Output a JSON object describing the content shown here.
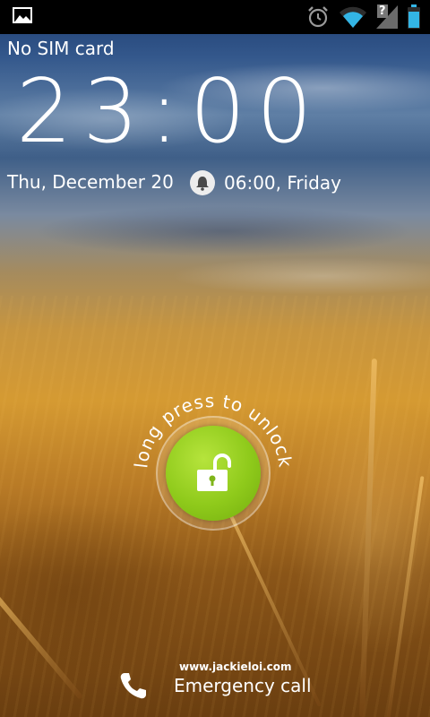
{
  "status_bar": {
    "icons_left": [
      "gallery-icon"
    ],
    "icons_right": [
      "alarm-icon",
      "wifi-icon",
      "no-sim-icon",
      "battery-icon"
    ],
    "no_sim_glyph": "?"
  },
  "lockscreen": {
    "carrier": "No SIM card",
    "time": "23:00",
    "date": "Thu, December 20",
    "next_alarm": "06:00, Friday",
    "unlock_hint": "long press to unlock",
    "watermark": "www.jackieloi.com",
    "emergency_label": "Emergency call"
  },
  "colors": {
    "status_bar_bg": "#000000",
    "unlock_green": "#8fca1b",
    "wifi_blue": "#33b5e5"
  }
}
